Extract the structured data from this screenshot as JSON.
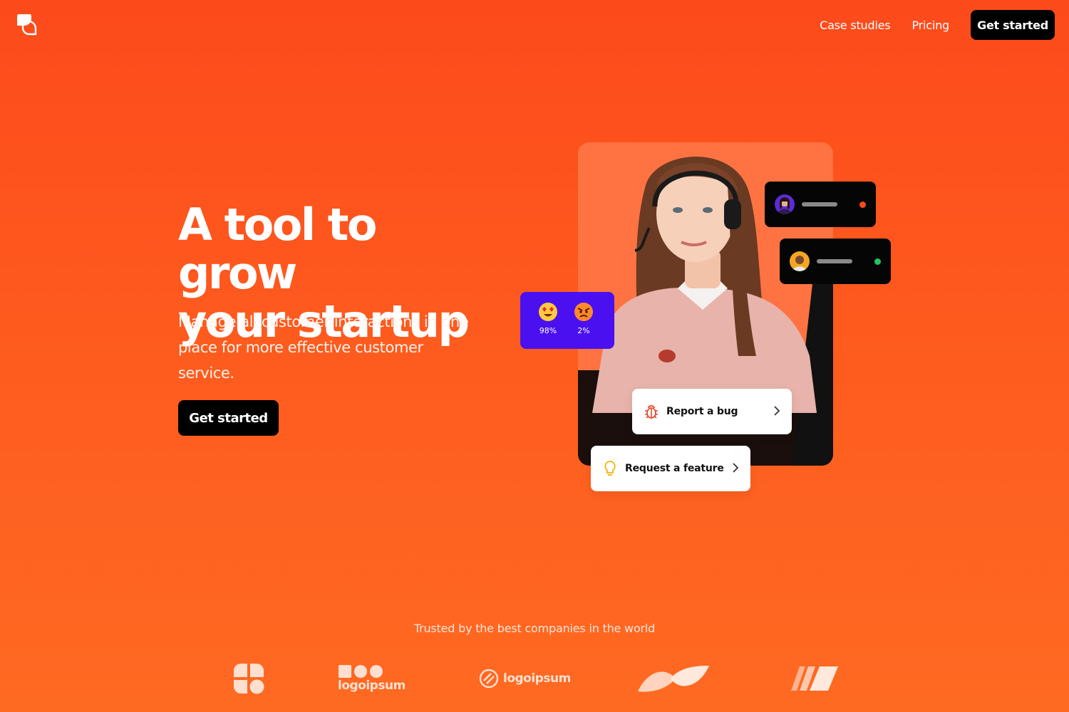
{
  "nav": {
    "logo_icon": "chat-bubbles-icon",
    "links": [
      "Case studies",
      "Pricing"
    ],
    "cta": "Get started"
  },
  "hero": {
    "title_line1": "A tool to grow",
    "title_line2": "your startup",
    "subtitle": "Manage all customer interactions in one place for more effective customer service.",
    "cta": "Get started"
  },
  "visual": {
    "agents": [
      {
        "status_color": "#ff4a1a"
      },
      {
        "status_color": "#22c55e"
      }
    ],
    "sentiment": {
      "positive": {
        "icon": "heart-eyes-emoji-icon",
        "value": "98%"
      },
      "negative": {
        "icon": "angry-face-emoji-icon",
        "value": "2%"
      }
    },
    "actions": [
      {
        "label": "Report a bug",
        "icon": "bug-icon"
      },
      {
        "label": "Request a feature",
        "icon": "lightbulb-icon"
      }
    ]
  },
  "trusted": {
    "heading": "Trusted by the best companies in the world",
    "logos": [
      "logoipsum",
      "logoipsum"
    ]
  },
  "colors": {
    "background_top": "#fd4a1b",
    "background_bottom": "#ff6a22",
    "sentiment_card": "#4a10f0",
    "button": "#000000"
  }
}
